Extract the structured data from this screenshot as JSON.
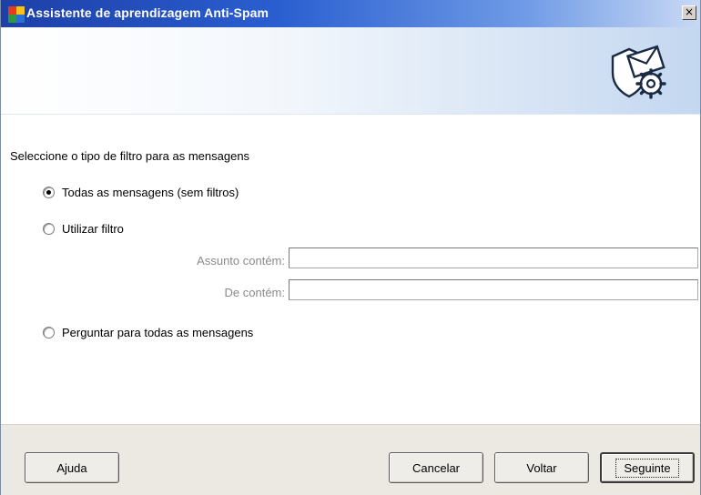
{
  "window": {
    "title": "Assistente de aprendizagem Anti-Spam",
    "close_glyph": "×"
  },
  "banner": {
    "icon": "shield-envelope-gear-icon"
  },
  "form": {
    "prompt": "Seleccione o tipo de filtro para as mensagens",
    "options": [
      {
        "label": "Todas as mensagens (sem filtros)",
        "selected": true
      },
      {
        "label": "Utilizar filtro",
        "selected": false
      },
      {
        "label": "Perguntar para todas as mensagens",
        "selected": false
      }
    ],
    "subject_label": "Assunto contém:",
    "subject_value": "",
    "from_label": "De contém:",
    "from_value": ""
  },
  "footer": {
    "help_label": "Ajuda",
    "cancel_label": "Cancelar",
    "back_label": "Voltar",
    "next_label": "Seguinte"
  }
}
